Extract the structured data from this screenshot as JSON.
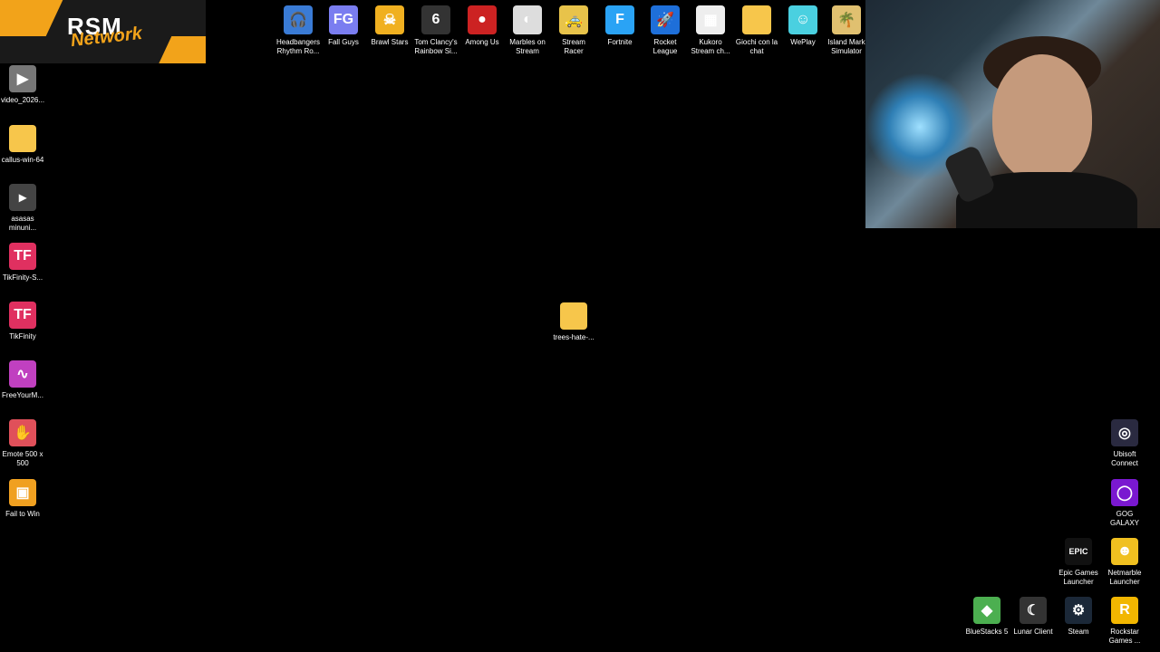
{
  "logo": {
    "line1": "RSM",
    "line2": "Network"
  },
  "top_icons": [
    {
      "label": "Headbangers Rhythm Ro...",
      "color": "#3a7bd5",
      "glyph": "🎧"
    },
    {
      "label": "Fall Guys",
      "color": "#7a7df0",
      "glyph": "FG"
    },
    {
      "label": "Brawl Stars",
      "color": "#f0b020",
      "glyph": "☠"
    },
    {
      "label": "Tom Clancy's Rainbow Si...",
      "color": "#333",
      "glyph": "6"
    },
    {
      "label": "Among Us",
      "color": "#c22",
      "glyph": "●"
    },
    {
      "label": "Marbles on Stream",
      "color": "#ddd",
      "glyph": "◐"
    },
    {
      "label": "Stream Racer",
      "color": "#e8c34a",
      "glyph": "🚕"
    },
    {
      "label": "Fortnite",
      "color": "#2aa3f5",
      "glyph": "F"
    },
    {
      "label": "Rocket League",
      "color": "#1e6fd9",
      "glyph": "🚀"
    },
    {
      "label": "Kukoro Stream ch...",
      "color": "#eee",
      "glyph": "▦"
    },
    {
      "label": "Giochi con la chat",
      "color": "#f7c64b",
      "glyph": ""
    },
    {
      "label": "WePlay",
      "color": "#4ad0e0",
      "glyph": "☺"
    },
    {
      "label": "Island Mark Simulator",
      "color": "#e0c070",
      "glyph": "🌴"
    }
  ],
  "left_icons": [
    {
      "label": "video_2026...",
      "color": "#777",
      "glyph": "▶"
    },
    {
      "label": "callus-win-64",
      "color": "#f7c64b",
      "glyph": ""
    },
    {
      "label": "asasas minuni...",
      "color": "#444",
      "glyph": "▸"
    },
    {
      "label": "TikFinity-S...",
      "color": "#e03060",
      "glyph": "TF"
    },
    {
      "label": "TikFinity",
      "color": "#e03060",
      "glyph": "TF"
    },
    {
      "label": "FreeYourM...",
      "color": "#c040c0",
      "glyph": "∿"
    },
    {
      "label": "Emote 500 x 500",
      "color": "#e0505a",
      "glyph": "✋"
    },
    {
      "label": "Fail to Win",
      "color": "#f0a020",
      "glyph": "▣"
    }
  ],
  "center_folder": {
    "label": "trees-hate-..."
  },
  "right_icons": [
    {
      "label": "Ubisoft Connect",
      "color": "#2a2a40",
      "glyph": "◎"
    },
    {
      "label": "GOG GALAXY",
      "color": "#7a18d0",
      "glyph": "◯"
    },
    {
      "label": "Epic Games Launcher",
      "color": "#111",
      "glyph": "EPIC"
    },
    {
      "label": "Netmarble Launcher",
      "color": "#f0c020",
      "glyph": "☻"
    },
    {
      "label": "BlueStacks 5",
      "color": "#4caf50",
      "glyph": "◆"
    },
    {
      "label": "Lunar Client",
      "color": "#333",
      "glyph": "☾"
    },
    {
      "label": "Steam",
      "color": "#1b2838",
      "glyph": "⚙"
    },
    {
      "label": "Rockstar Games ...",
      "color": "#f2b600",
      "glyph": "R"
    }
  ]
}
